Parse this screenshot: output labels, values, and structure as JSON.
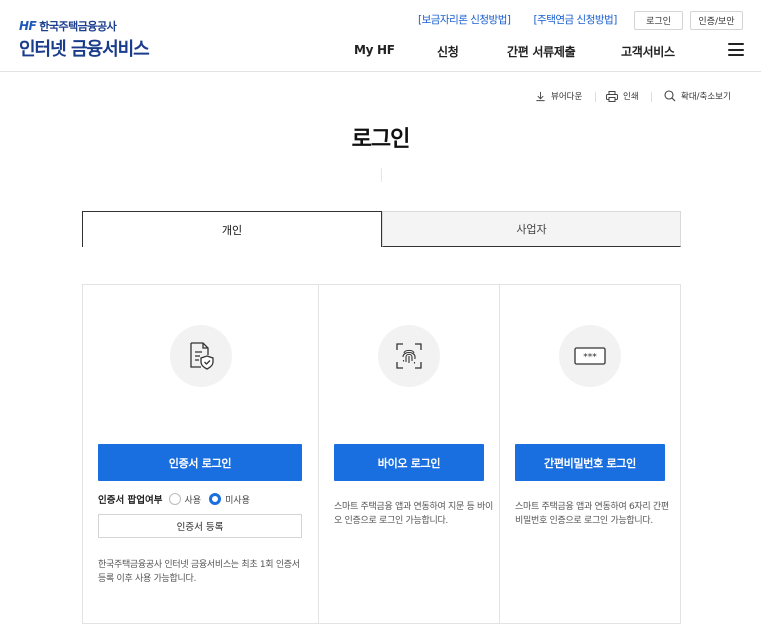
{
  "header": {
    "logo_hf": "HF",
    "logo_org": "한국주택금융공사",
    "logo_title": "인터넷 금융서비스",
    "top_links": [
      "[보금자리론 신청방법]",
      "[주택연금 신청방법]"
    ],
    "login_label": "로그인",
    "cert_label": "인증/보안",
    "nav": [
      "My HF",
      "신청",
      "간편 서류제출",
      "고객서비스"
    ],
    "menu_icon": "hamburger-menu-icon"
  },
  "utility": {
    "viewer_download": "뷰어다운",
    "print": "인쇄",
    "zoom": "확대/축소보기"
  },
  "page": {
    "title": "로그인"
  },
  "tabs": {
    "personal": "개인",
    "business": "사업자",
    "active": "personal"
  },
  "login": {
    "cert": {
      "icon": "certificate-shield-icon",
      "button": "인증서 로그인",
      "popup_label": "인증서 팝업여부",
      "option_use": "사용",
      "option_nouse": "미사용",
      "selected": "미사용",
      "register_button": "인증서 등록",
      "desc": "한국주택금융공사 인터넷 금융서비스는 최초 1회 인증서 등록 이후 사용 가능합니다."
    },
    "bio": {
      "icon": "fingerprint-icon",
      "button": "바이오 로그인",
      "desc": "스마트 주택금융 앱과 연동하여 지문 등 바이오 인증으로 로그인 가능합니다."
    },
    "pin": {
      "icon": "password-icon",
      "icon_text": "***",
      "button": "간편비밀번호 로그인",
      "desc": "스마트 주택금융 앱과 연동하여 6자리 간편비밀번호 인증으로 로그인 가능합니다."
    }
  },
  "colors": {
    "primary": "#1a6fe0",
    "logo_blue": "#1a3c8c",
    "link_blue": "#1a5fd0"
  }
}
